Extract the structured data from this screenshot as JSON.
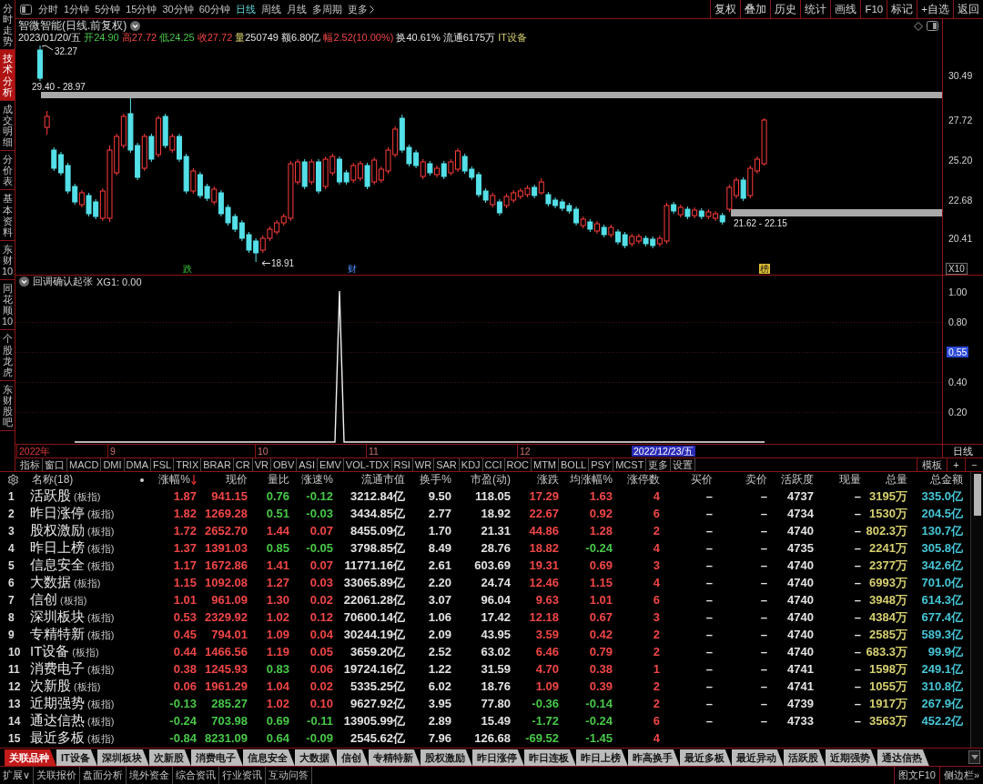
{
  "sidebar": {
    "tabs": [
      {
        "label": "分时走势",
        "selected": false
      },
      {
        "label": "技术分析",
        "selected": true
      },
      {
        "label": "成交明细",
        "selected": false
      },
      {
        "label": "分价表",
        "selected": false
      },
      {
        "label": "基本资料",
        "selected": false
      },
      {
        "label": "东财10",
        "selected": false
      },
      {
        "label": "同花顺10",
        "selected": false
      },
      {
        "label": "个股龙虎",
        "selected": false
      },
      {
        "label": "东财股吧",
        "selected": false
      }
    ]
  },
  "toolbar": {
    "periods": [
      {
        "label": "分时",
        "kind": "period",
        "selected": false
      },
      {
        "label": "1分钟",
        "kind": "period",
        "selected": false
      },
      {
        "label": "5分钟",
        "kind": "period",
        "selected": false
      },
      {
        "label": "15分钟",
        "kind": "period",
        "selected": false
      },
      {
        "label": "30分钟",
        "kind": "period",
        "selected": false
      },
      {
        "label": "60分钟",
        "kind": "period",
        "selected": false
      },
      {
        "label": "日线",
        "kind": "period",
        "selected": true
      },
      {
        "label": "周线",
        "kind": "period",
        "selected": false
      },
      {
        "label": "月线",
        "kind": "period",
        "selected": false
      },
      {
        "label": "多周期",
        "kind": "period",
        "selected": false
      },
      {
        "label": "更多",
        "kind": "menu",
        "selected": false
      }
    ],
    "buttons": [
      "复权",
      "叠加",
      "历史",
      "统计",
      "画线",
      "F10",
      "标记",
      "+自选",
      "返回"
    ]
  },
  "chart": {
    "title": "智微智能(日线.前复权)",
    "date": "2023/01/20/五",
    "quote": [
      {
        "label": "开",
        "value": "24.90",
        "kind": "down"
      },
      {
        "label": "高",
        "value": "27.72",
        "kind": "up"
      },
      {
        "label": "低",
        "value": "24.25",
        "kind": "down"
      },
      {
        "label": "收",
        "value": "27.72",
        "kind": "up"
      },
      {
        "label": "量",
        "value": "250749",
        "kind": "volume"
      },
      {
        "label": "额",
        "value": "6.80亿",
        "kind": "plain"
      },
      {
        "label": "幅",
        "value": "2.52(10.00%)",
        "kind": "up"
      },
      {
        "label": "换",
        "value": "40.61%",
        "kind": "plain"
      },
      {
        "label": "流通",
        "value": "6175万",
        "kind": "plain"
      }
    ],
    "sector": "IT设备",
    "annotations": [
      {
        "text": "32.27",
        "kind": "high"
      },
      {
        "text": "29.40 - 28.97",
        "kind": "range"
      },
      {
        "text": "21.62 - 22.15",
        "kind": "range"
      },
      {
        "text": "18.91",
        "kind": "low"
      }
    ],
    "events": [
      {
        "text": "跌",
        "kind": "drop"
      },
      {
        "text": "财",
        "kind": "finance"
      },
      {
        "text": "榜",
        "kind": "list"
      }
    ],
    "price_axis": [
      "30.49",
      "27.72",
      "25.20",
      "22.68",
      "20.41"
    ],
    "scale": "X10"
  },
  "indicator": {
    "title": "回调确认起张",
    "reading": "XG1: 0.00",
    "axis": [
      {
        "label": "1.00",
        "highlighted": false
      },
      {
        "label": "0.80",
        "highlighted": false
      },
      {
        "label": "0.55",
        "highlighted": true
      },
      {
        "label": "0.40",
        "highlighted": false
      },
      {
        "label": "0.20",
        "highlighted": false
      }
    ]
  },
  "date_axis": {
    "labels": [
      "2022年",
      "9",
      "10",
      "11",
      "12"
    ],
    "cursor": "2022/12/23/五",
    "period": "日线"
  },
  "indicator_tabs": {
    "items": [
      "指标",
      "窗口",
      "MACD",
      "DMI",
      "DMA",
      "FSL",
      "TRIX",
      "BRAR",
      "CR",
      "VR",
      "OBV",
      "ASI",
      "EMV",
      "VOL-TDX",
      "RSI",
      "WR",
      "SAR",
      "KDJ",
      "CCI",
      "ROC",
      "MTM",
      "BOLL",
      "PSY",
      "MCST",
      "更多",
      "设置"
    ],
    "actions": [
      "模板",
      "+",
      "−"
    ]
  },
  "table": {
    "name_column": {
      "label": "名称(18)"
    },
    "columns": [
      {
        "label": "涨幅%",
        "kind": "change",
        "sorted": true
      },
      {
        "label": "现价",
        "kind": "change",
        "sorted": false
      },
      {
        "label": "量比",
        "kind": "ratio",
        "sorted": false
      },
      {
        "label": "涨速%",
        "kind": "speed",
        "sorted": false
      },
      {
        "label": "流通市值",
        "kind": "plain",
        "sorted": false
      },
      {
        "label": "换手%",
        "kind": "plain",
        "sorted": false
      },
      {
        "label": "市盈(动)",
        "kind": "plain",
        "sorted": false
      },
      {
        "label": "涨跌",
        "kind": "change",
        "sorted": false
      },
      {
        "label": "均涨幅%",
        "kind": "average",
        "sorted": false
      },
      {
        "label": "涨停数",
        "kind": "limit",
        "sorted": false
      },
      {
        "label": "买价",
        "kind": "plain",
        "sorted": false
      },
      {
        "label": "卖价",
        "kind": "plain",
        "sorted": false
      },
      {
        "label": "活跃度",
        "kind": "plain",
        "sorted": false
      },
      {
        "label": "现量",
        "kind": "plain",
        "sorted": false
      },
      {
        "label": "总量",
        "kind": "volume",
        "sorted": false
      },
      {
        "label": "总金额",
        "kind": "amount",
        "sorted": false
      }
    ],
    "rows": [
      {
        "index": "1",
        "name": "活跃股",
        "tag": "(板指)",
        "rising": true,
        "volume_ratio_high": false,
        "speed_rising": false,
        "average_rising": true,
        "cells": [
          "1.87",
          "941.15",
          "0.76",
          "-0.12",
          "3212.84亿",
          "9.50",
          "118.05",
          "17.29",
          "1.63",
          "4",
          "–",
          "–",
          "4737",
          "–",
          "3195万",
          "335.0亿"
        ]
      },
      {
        "index": "2",
        "name": "昨日涨停",
        "tag": "(板指)",
        "rising": true,
        "volume_ratio_high": false,
        "speed_rising": false,
        "average_rising": true,
        "cells": [
          "1.82",
          "1269.28",
          "0.51",
          "-0.03",
          "3434.85亿",
          "2.77",
          "18.92",
          "22.67",
          "0.92",
          "6",
          "–",
          "–",
          "4734",
          "–",
          "1530万",
          "204.5亿"
        ]
      },
      {
        "index": "3",
        "name": "股权激励",
        "tag": "(板指)",
        "rising": true,
        "volume_ratio_high": true,
        "speed_rising": true,
        "average_rising": true,
        "cells": [
          "1.72",
          "2652.70",
          "1.44",
          "0.07",
          "8455.09亿",
          "1.70",
          "21.31",
          "44.86",
          "1.28",
          "2",
          "–",
          "–",
          "4740",
          "–",
          "802.3万",
          "130.7亿"
        ]
      },
      {
        "index": "4",
        "name": "昨日上榜",
        "tag": "(板指)",
        "rising": true,
        "volume_ratio_high": false,
        "speed_rising": false,
        "average_rising": false,
        "cells": [
          "1.37",
          "1391.03",
          "0.85",
          "-0.05",
          "3798.85亿",
          "8.49",
          "28.76",
          "18.82",
          "-0.24",
          "4",
          "–",
          "–",
          "4735",
          "–",
          "2241万",
          "305.8亿"
        ]
      },
      {
        "index": "5",
        "name": "信息安全",
        "tag": "(板指)",
        "rising": true,
        "volume_ratio_high": true,
        "speed_rising": true,
        "average_rising": true,
        "cells": [
          "1.17",
          "1672.86",
          "1.41",
          "0.07",
          "11771.16亿",
          "2.61",
          "603.69",
          "19.31",
          "0.69",
          "3",
          "–",
          "–",
          "4740",
          "–",
          "2377万",
          "342.6亿"
        ]
      },
      {
        "index": "6",
        "name": "大数据",
        "tag": "(板指)",
        "rising": true,
        "volume_ratio_high": true,
        "speed_rising": true,
        "average_rising": true,
        "cells": [
          "1.15",
          "1092.08",
          "1.27",
          "0.03",
          "33065.89亿",
          "2.20",
          "24.74",
          "12.46",
          "1.15",
          "4",
          "–",
          "–",
          "4740",
          "–",
          "6993万",
          "701.0亿"
        ]
      },
      {
        "index": "7",
        "name": "信创",
        "tag": "(板指)",
        "rising": true,
        "volume_ratio_high": true,
        "speed_rising": true,
        "average_rising": true,
        "cells": [
          "1.01",
          "961.09",
          "1.30",
          "0.02",
          "22061.28亿",
          "3.07",
          "96.04",
          "9.63",
          "1.01",
          "6",
          "–",
          "–",
          "4740",
          "–",
          "3948万",
          "614.3亿"
        ]
      },
      {
        "index": "8",
        "name": "深圳板块",
        "tag": "(板指)",
        "rising": true,
        "volume_ratio_high": true,
        "speed_rising": true,
        "average_rising": true,
        "cells": [
          "0.53",
          "2329.92",
          "1.02",
          "0.12",
          "70600.14亿",
          "1.06",
          "17.42",
          "12.18",
          "0.67",
          "3",
          "–",
          "–",
          "4740",
          "–",
          "4384万",
          "677.4亿"
        ]
      },
      {
        "index": "9",
        "name": "专精特新",
        "tag": "(板指)",
        "rising": true,
        "volume_ratio_high": true,
        "speed_rising": true,
        "average_rising": true,
        "cells": [
          "0.45",
          "794.01",
          "1.09",
          "0.04",
          "30244.19亿",
          "2.09",
          "43.95",
          "3.59",
          "0.42",
          "2",
          "–",
          "–",
          "4740",
          "–",
          "2585万",
          "589.3亿"
        ]
      },
      {
        "index": "10",
        "name": "IT设备",
        "tag": "(板指)",
        "rising": true,
        "volume_ratio_high": true,
        "speed_rising": true,
        "average_rising": true,
        "cells": [
          "0.44",
          "1466.56",
          "1.19",
          "0.05",
          "3659.20亿",
          "2.52",
          "63.02",
          "6.46",
          "0.79",
          "2",
          "–",
          "–",
          "4740",
          "–",
          "683.3万",
          "99.9亿"
        ]
      },
      {
        "index": "11",
        "name": "消费电子",
        "tag": "(板指)",
        "rising": true,
        "volume_ratio_high": false,
        "speed_rising": true,
        "average_rising": true,
        "cells": [
          "0.38",
          "1245.93",
          "0.83",
          "0.06",
          "19724.16亿",
          "1.22",
          "31.59",
          "4.70",
          "0.38",
          "1",
          "–",
          "–",
          "4741",
          "–",
          "1598万",
          "249.1亿"
        ]
      },
      {
        "index": "12",
        "name": "次新股",
        "tag": "(板指)",
        "rising": true,
        "volume_ratio_high": true,
        "speed_rising": true,
        "average_rising": true,
        "cells": [
          "0.06",
          "1961.29",
          "1.04",
          "0.02",
          "5335.25亿",
          "6.02",
          "18.76",
          "1.09",
          "0.39",
          "2",
          "–",
          "–",
          "4741",
          "–",
          "1055万",
          "310.8亿"
        ]
      },
      {
        "index": "13",
        "name": "近期强势",
        "tag": "(板指)",
        "rising": false,
        "volume_ratio_high": true,
        "speed_rising": true,
        "average_rising": false,
        "cells": [
          "-0.13",
          "285.27",
          "1.02",
          "0.10",
          "9627.92亿",
          "3.95",
          "77.80",
          "-0.36",
          "-0.14",
          "2",
          "–",
          "–",
          "4739",
          "–",
          "1917万",
          "267.9亿"
        ]
      },
      {
        "index": "14",
        "name": "通达信热",
        "tag": "(板指)",
        "rising": false,
        "volume_ratio_high": false,
        "speed_rising": false,
        "average_rising": false,
        "cells": [
          "-0.24",
          "703.98",
          "0.69",
          "-0.11",
          "13905.99亿",
          "2.89",
          "15.49",
          "-1.72",
          "-0.24",
          "6",
          "–",
          "–",
          "4733",
          "–",
          "3563万",
          "452.2亿"
        ]
      },
      {
        "index": "15",
        "name": "最近多板",
        "tag": "(板指)",
        "rising": false,
        "volume_ratio_high": false,
        "speed_rising": false,
        "average_rising": false,
        "cells": [
          "-0.84",
          "8231.09",
          "0.64",
          "-0.09",
          "2545.62亿",
          "7.96",
          "126.68",
          "-69.52",
          "-1.45",
          "4"
        ]
      }
    ]
  },
  "related_tabs": [
    {
      "label": "关联品种",
      "selected": true
    },
    {
      "label": "IT设备",
      "selected": false
    },
    {
      "label": "深圳板块",
      "selected": false
    },
    {
      "label": "次新股",
      "selected": false
    },
    {
      "label": "消费电子",
      "selected": false
    },
    {
      "label": "信息安全",
      "selected": false
    },
    {
      "label": "大数据",
      "selected": false
    },
    {
      "label": "信创",
      "selected": false
    },
    {
      "label": "专精特新",
      "selected": false
    },
    {
      "label": "股权激励",
      "selected": false
    },
    {
      "label": "昨日涨停",
      "selected": false
    },
    {
      "label": "昨日连板",
      "selected": false
    },
    {
      "label": "昨日上榜",
      "selected": false
    },
    {
      "label": "昨高换手",
      "selected": false
    },
    {
      "label": "最近多板",
      "selected": false
    },
    {
      "label": "最近异动",
      "selected": false
    },
    {
      "label": "活跃股",
      "selected": false
    },
    {
      "label": "近期强势",
      "selected": false
    },
    {
      "label": "通达信热",
      "selected": false
    }
  ],
  "status_bar": {
    "items": [
      "扩展∨",
      "关联报价",
      "盘面分析",
      "境外资金",
      "综合资讯",
      "行业资讯",
      "互动问答"
    ],
    "right": [
      "图文F10",
      "侧边栏»"
    ]
  }
}
